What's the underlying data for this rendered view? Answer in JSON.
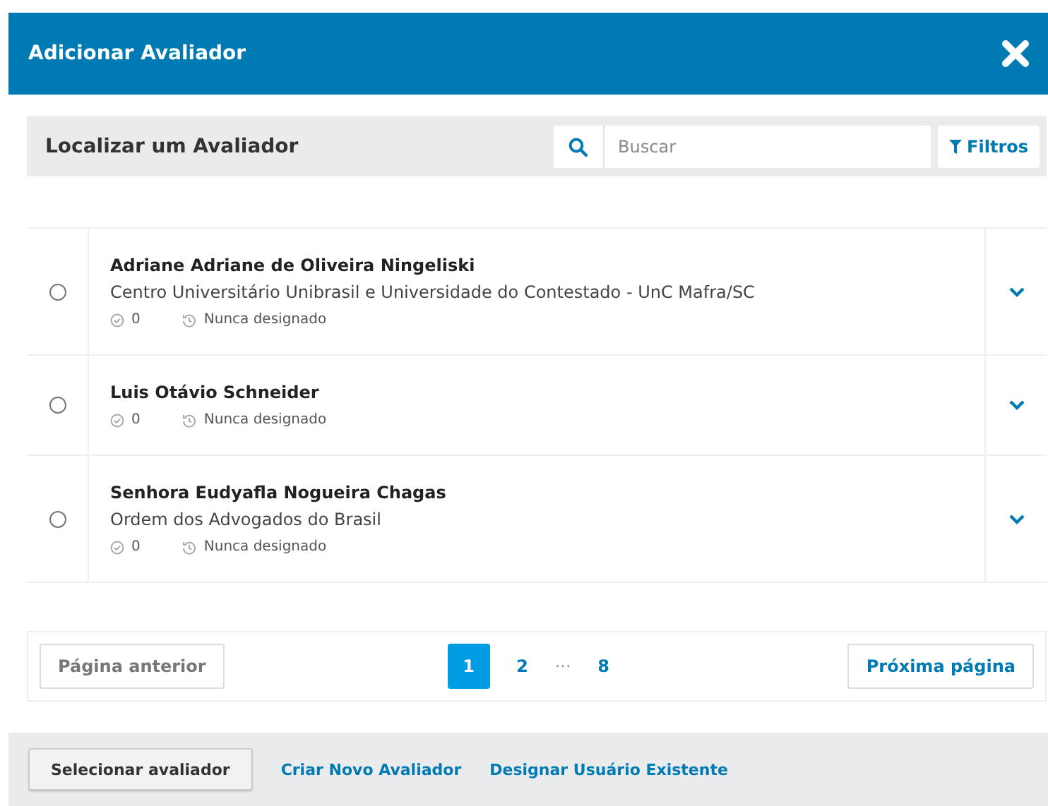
{
  "window": {
    "title": "Adicionar Avaliador"
  },
  "panel": {
    "title": "Localizar um Avaliador",
    "search": {
      "placeholder": "Buscar"
    },
    "filter_button": "Filtros"
  },
  "reviewers": [
    {
      "name": "Adriane Adriane de Oliveira Ningeliski",
      "affiliation": "Centro Universitário Unibrasil e Universidade do Contestado - UnC Mafra/SC",
      "count": "0",
      "last_assigned": "Nunca designado",
      "selected": false
    },
    {
      "name": "Luis Otávio Schneider",
      "count": "0",
      "last_assigned": "Nunca designado",
      "selected": false
    },
    {
      "name": "Senhora Eudyafla Nogueira Chagas",
      "affiliation": "Ordem dos Advogados do Brasil",
      "count": "0",
      "last_assigned": "Nunca designado",
      "selected": false
    }
  ],
  "pagination": {
    "previous": {
      "label": "Página anterior",
      "disabled": true
    },
    "next": {
      "label": "Próxima página",
      "disabled": false
    },
    "pages": [
      {
        "kind": "page",
        "label": "1",
        "selected": true
      },
      {
        "kind": "page",
        "label": "2",
        "selected": false
      },
      {
        "kind": "ellipsis",
        "label": "···"
      },
      {
        "kind": "page",
        "label": "8",
        "selected": false
      }
    ]
  },
  "footer": {
    "primary_button": "Selecionar avaliador",
    "links": [
      "Criar Novo Avaliador",
      "Designar Usuário Existente"
    ]
  }
}
